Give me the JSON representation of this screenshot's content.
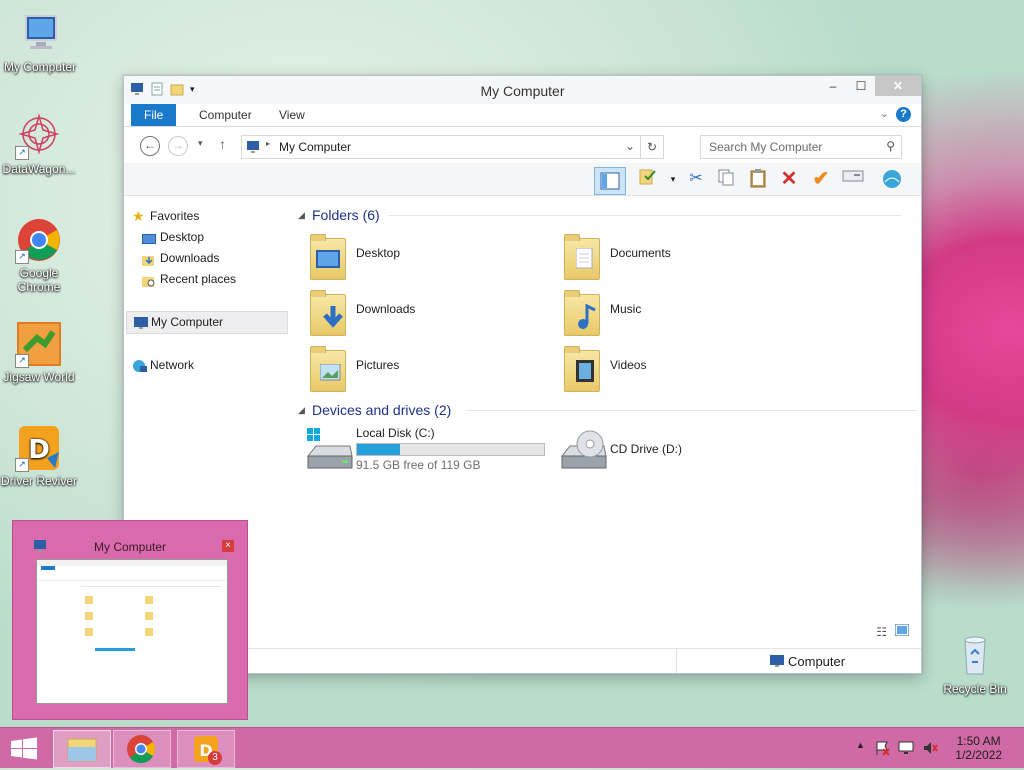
{
  "desktop": {
    "icons": [
      {
        "label": "My Computer"
      },
      {
        "label": "DataWagon..."
      },
      {
        "label": "Google Chrome"
      },
      {
        "label": "Jigsaw World"
      },
      {
        "label": "Driver Reviver"
      },
      {
        "label": "Recycle Bin"
      }
    ]
  },
  "window": {
    "title": "My Computer",
    "ribbon_tabs": [
      "File",
      "Computer",
      "View"
    ],
    "address": "My Computer",
    "search_placeholder": "Search My Computer",
    "nav": {
      "favorites_label": "Favorites",
      "favorites_items": [
        "Desktop",
        "Downloads",
        "Recent places"
      ],
      "computer_label": "My Computer",
      "network_label": "Network"
    },
    "groups": {
      "folders_header": "Folders (6)",
      "folders": [
        "Desktop",
        "Documents",
        "Downloads",
        "Music",
        "Pictures",
        "Videos"
      ],
      "devices_header": "Devices and drives (2)",
      "drive_c_name": "Local Disk (C:)",
      "drive_c_free": "91.5 GB free of 119 GB",
      "drive_c_used_fraction": 0.23,
      "drive_d_name": "CD Drive (D:)"
    },
    "status_text": "Computer"
  },
  "preview": {
    "title": "My Computer",
    "close_glyph": "×"
  },
  "taskbar": {
    "time": "1:50 AM",
    "date": "1/2/2022",
    "badge_count": "3"
  },
  "colors": {
    "accent": "#1979ca",
    "taskbar": "#d06aa6",
    "drive_fill": "#26a0da"
  }
}
